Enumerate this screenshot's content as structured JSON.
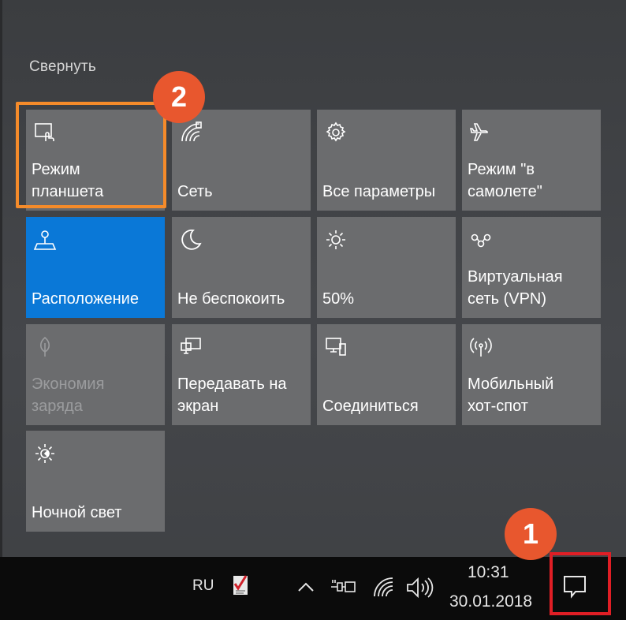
{
  "panel": {
    "collapse_label": "Свернуть"
  },
  "tiles": [
    {
      "label": "Режим\nпланшета",
      "icon": "tablet-mode-icon",
      "state": "off"
    },
    {
      "label": "Сеть",
      "icon": "network-icon",
      "state": "off"
    },
    {
      "label": "Все параметры",
      "icon": "gear-icon",
      "state": "off"
    },
    {
      "label": "Режим \"в\nсамолете\"",
      "icon": "airplane-icon",
      "state": "off"
    },
    {
      "label": "Расположение",
      "icon": "location-icon",
      "state": "on"
    },
    {
      "label": "Не беспокоить",
      "icon": "moon-icon",
      "state": "off"
    },
    {
      "label": "50%",
      "icon": "brightness-icon",
      "state": "off"
    },
    {
      "label": "Виртуальная\nсеть (VPN)",
      "icon": "vpn-icon",
      "state": "off"
    },
    {
      "label": "Экономия\nзаряда",
      "icon": "leaf-icon",
      "state": "disabled"
    },
    {
      "label": "Передавать на\nэкран",
      "icon": "project-icon",
      "state": "off"
    },
    {
      "label": "Соединиться",
      "icon": "connect-icon",
      "state": "off"
    },
    {
      "label": "Мобильный\nхот-спот",
      "icon": "hotspot-icon",
      "state": "off"
    },
    {
      "label": "Ночной свет",
      "icon": "night-light-icon",
      "state": "off"
    }
  ],
  "annotations": {
    "step1": "1",
    "step2": "2"
  },
  "taskbar": {
    "language": "RU",
    "time": "10:31",
    "date": "30.01.2018"
  },
  "colors": {
    "tile": "#6b6c6e",
    "tile_active": "#0a78d7",
    "highlight_orange": "#f58b2a",
    "badge": "#e8572e",
    "action_center_box": "#e01e25"
  }
}
